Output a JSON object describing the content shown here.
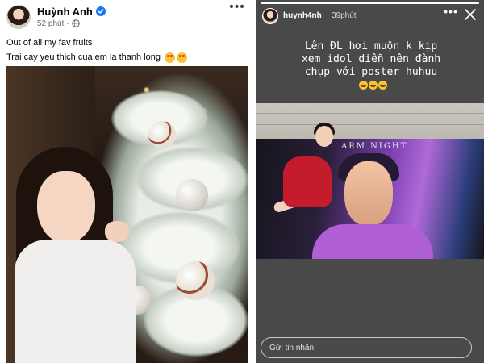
{
  "facebook_post": {
    "author": "Huỳnh Anh",
    "time": "52 phút",
    "separator": "·",
    "more_label": "•••",
    "caption_lines": [
      "Out of all my fav fruits",
      "Trai cay yeu thich cua em la thanh long"
    ],
    "verified_icon": "verified-badge-icon",
    "privacy_icon": "globe-icon",
    "caption_emoji": "smiling-face-with-hearts-icon"
  },
  "instagram_story": {
    "username": "huynh4nh",
    "time": "39phút",
    "more_label": "•••",
    "story_lines": [
      "Lên ĐL hơi muộn k kịp",
      "xem idol diễn nên đành",
      "chụp với poster huhuu"
    ],
    "story_emoji": "face-with-tears-of-joy-icon",
    "poster_title": "ARM NIGHT",
    "progress": 1.0,
    "reply_placeholder": "Gửi tin nhắn"
  },
  "colors": {
    "story_background": "#494949",
    "verified_blue": "#1877f2",
    "text_primary": "#050505",
    "text_secondary": "#65676b"
  }
}
